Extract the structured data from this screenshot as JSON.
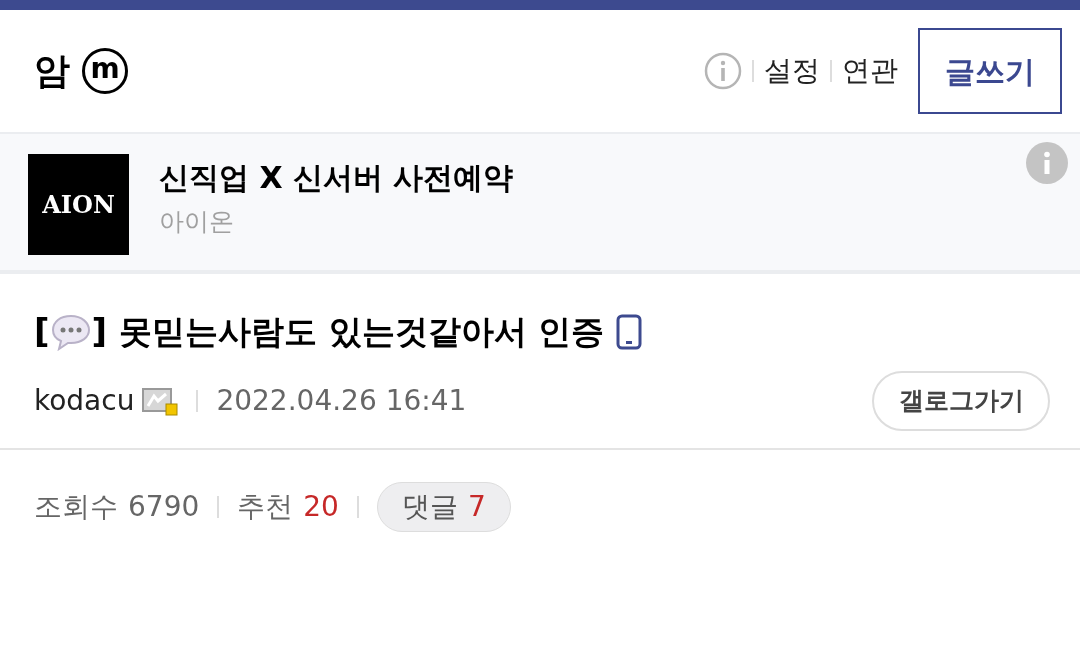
{
  "header": {
    "title": "암",
    "badge": "m",
    "links": [
      "설정",
      "연관"
    ],
    "write_button": "글쓰기"
  },
  "ad": {
    "logo_text": "AION",
    "title": "신직업 X 신서버 사전예약",
    "advertiser": "아이온"
  },
  "post": {
    "bracket_open": "[",
    "bracket_close": "]",
    "title": "못믿는사람도 있는것같아서 인증",
    "author": "kodacu",
    "date": "2022.04.26 16:41",
    "gallery_button": "갤로그가기"
  },
  "stats": {
    "views_label": "조회수",
    "views": "6790",
    "recommend_label": "추천",
    "recommend": "20",
    "comments_label": "댓글",
    "comments": "7"
  }
}
